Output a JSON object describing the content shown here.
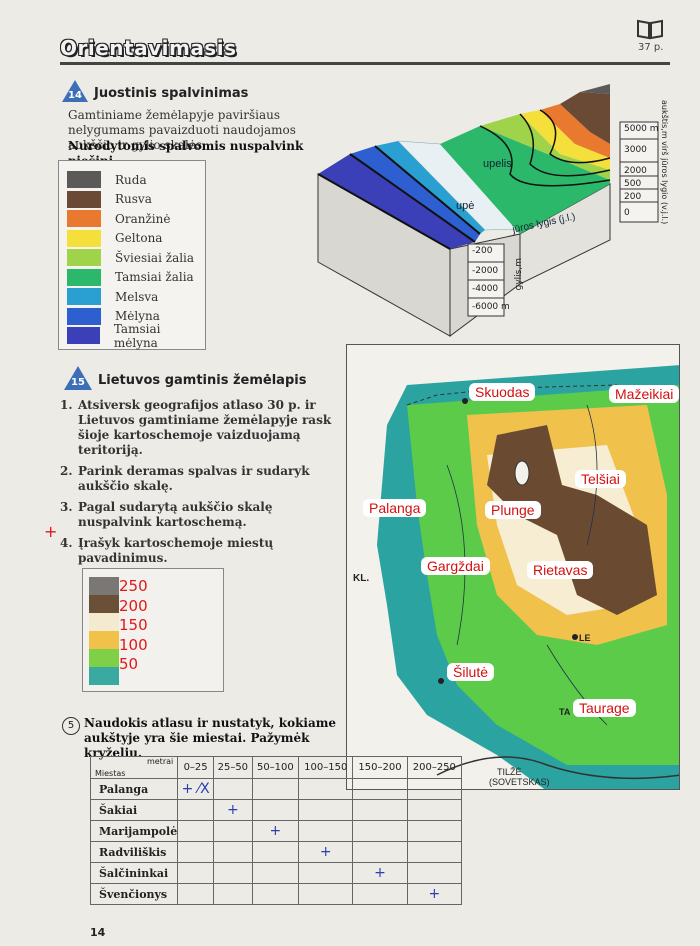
{
  "header": {
    "title": "Orientavimasis",
    "page_ref": "37 p."
  },
  "task14": {
    "number": "14",
    "title": "Juostinis spalvinimas",
    "intro": "Gamtiniame žemėlapyje paviršiaus nelygumams pavaizduoti naudojamos aukščio ir gylio skalės.",
    "instruction": "Nurodytomis spalvomis nuspalvink piešinį.",
    "colors": [
      {
        "label": "Ruda",
        "color": "#5b5a58"
      },
      {
        "label": "Rusva",
        "color": "#6b4a35"
      },
      {
        "label": "Oranžinė",
        "color": "#e9792e"
      },
      {
        "label": "Geltona",
        "color": "#f5df3a"
      },
      {
        "label": "Šviesiai žalia",
        "color": "#9fd34a"
      },
      {
        "label": "Tamsiai žalia",
        "color": "#2bb86a"
      },
      {
        "label": "Melsva",
        "color": "#2a9fd1"
      },
      {
        "label": "Mėlyna",
        "color": "#2d5fd0"
      },
      {
        "label": "Tamsiai mėlyna",
        "color": "#3b3fb8"
      }
    ],
    "diagram": {
      "heights": [
        "5000 m",
        "3000",
        "2000",
        "500",
        "200",
        "0"
      ],
      "depths": [
        "-200",
        "-2000",
        "-4000",
        "-6000 m"
      ],
      "height_axis": "aukštis,m virš jūros lygio (v.j.l.)",
      "depth_axis": "gylis,m",
      "label_upelis": "upelis",
      "label_upe": "upė",
      "label_sea": "jūros lygis (j.l.)"
    }
  },
  "task15": {
    "number": "15",
    "title": "Lietuvos gamtinis žemėlapis",
    "steps": [
      {
        "num": "1.",
        "text": "Atsiversk geografijos atlaso 30 p. ir Lietuvos gamtiniame žemėlapyje rask šioje kartoschemoje vaizduojamą teritoriją."
      },
      {
        "num": "2.",
        "text": "Parink deramas spalvas ir sudaryk aukščio skalę."
      },
      {
        "num": "3.",
        "text": "Pagal sudarytą aukščio skalę nuspalvink kartoschemą."
      },
      {
        "num": "4.",
        "text": "Įrašyk kartoschemoje miestų pavadinimus."
      }
    ],
    "scale_labels": [
      "250",
      "200",
      "150",
      "100",
      "50"
    ],
    "scale_colors": [
      "#7a7774",
      "#6b5038",
      "#f3ead0",
      "#f2c14a",
      "#7fd047",
      "#3aaaa0"
    ]
  },
  "map": {
    "cities": [
      "Skuodas",
      "Mažeikiai",
      "Telšiai",
      "Palanga",
      "Plunge",
      "Gargždai",
      "Rietavas",
      "Šilutė",
      "Taurage"
    ],
    "printed_labels": {
      "kl": "KL.",
      "le": "LE",
      "ta": "TA",
      "tilze": "TILŽĖ",
      "sovetsk": "(SOVETSKAS)"
    }
  },
  "task5": {
    "number": "5",
    "question": "Naudokis atlasu ir nustatyk, kokiame aukštyje yra šie miestai. Pažymėk kryželiu.",
    "corner_top": "metrai",
    "corner_bottom": "Miestas",
    "columns": [
      "0–25",
      "25–50",
      "50–100",
      "100–150",
      "150–200",
      "200–250"
    ],
    "rows": [
      {
        "city": "Palanga",
        "marks": [
          "+ ⁄X",
          "",
          "",
          "",
          "",
          ""
        ]
      },
      {
        "city": "Šakiai",
        "marks": [
          "",
          "+",
          "",
          "",
          "",
          ""
        ]
      },
      {
        "city": "Marijampolė",
        "marks": [
          "",
          "",
          "+",
          "",
          "",
          ""
        ]
      },
      {
        "city": "Radviliškis",
        "marks": [
          "",
          "",
          "",
          "+",
          "",
          ""
        ]
      },
      {
        "city": "Šalčininkai",
        "marks": [
          "",
          "",
          "",
          "",
          "+",
          ""
        ]
      },
      {
        "city": "Švenčionys",
        "marks": [
          "",
          "",
          "",
          "",
          "",
          "+"
        ]
      }
    ]
  },
  "footer": {
    "page_number": "14"
  },
  "annotations": {
    "margin_plus": "+"
  }
}
